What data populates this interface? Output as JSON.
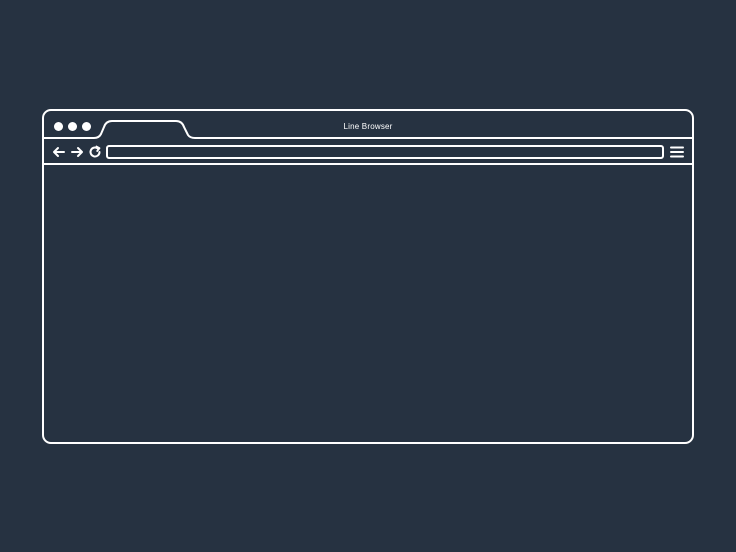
{
  "window": {
    "title": "Line Browser",
    "controls": [
      "close-dot",
      "minimize-dot",
      "maximize-dot"
    ]
  },
  "tab": {
    "label": ""
  },
  "toolbar": {
    "back_icon": "arrow-left-icon",
    "forward_icon": "arrow-right-icon",
    "reload_icon": "reload-icon",
    "menu_icon": "hamburger-menu-icon"
  },
  "address_bar": {
    "value": "",
    "placeholder": ""
  },
  "content": {
    "text": ""
  },
  "colors": {
    "background": "#263241",
    "stroke": "#ffffff"
  }
}
